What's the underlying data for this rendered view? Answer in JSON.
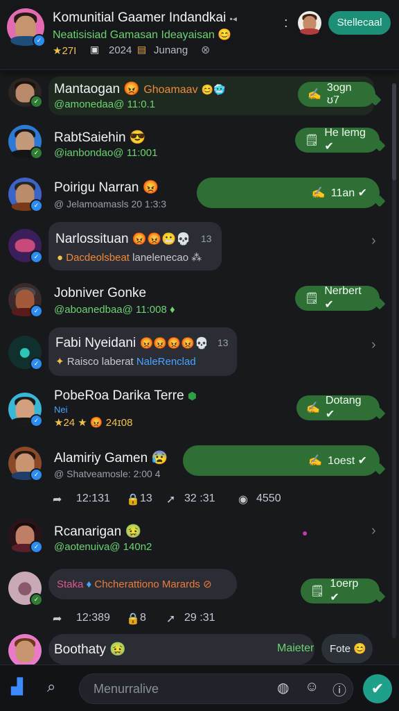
{
  "header": {
    "title": "Komunitial Gaamer Indandkai",
    "title_mark": "▪◂",
    "subtitle": "Neatisisiad Gamasan Ideayaisan",
    "subtitle_emoji": "😊",
    "stat_rating": "★27I",
    "stat_year": "2024",
    "stat_label": "Junang",
    "dots": ":",
    "button_label": "Stellecaal"
  },
  "chats": [
    {
      "name": "Mantaogan",
      "tag": "Ghoamaav",
      "emojis": "😡",
      "tag_emojis": "😊🥶",
      "handle": "@amonedaa@ 11:0.1",
      "action": {
        "icon": "✍",
        "label": "3ogn  ʊ7"
      }
    },
    {
      "name": "RabtSaiehin",
      "emojis": "😎",
      "handle": "@ianbondao@ 11:001",
      "action": {
        "icon": "🗒",
        "label": "He lemg ✔"
      }
    },
    {
      "name": "Poirigu Narran",
      "emojis": "😡",
      "handle": "@ Jelamoamasls 20 1:3:3",
      "action": {
        "icon": "✍",
        "label": "11an ✔"
      }
    },
    {
      "name": "Narlossituan",
      "emojis": "😡😡😬💀",
      "count": "13",
      "preview_left": "Dacdeolsbeat",
      "preview_right": "lanelenecao ⁂"
    },
    {
      "name": "Jobniver Gonke",
      "handle": "@aboanedbaa@ 11:008 ♦",
      "action": {
        "icon": "🗒",
        "label": "Nerbert ✔"
      }
    },
    {
      "name": "Fabi Nyeidani",
      "emojis": "😡😡😡😡💀",
      "count": "13",
      "preview_left": "Raisco laberat",
      "preview_right": "NaleRenclad"
    },
    {
      "name": "PobeRoa Darika Terre",
      "sub": "Nei",
      "stats": "★24  ★ 😡 24ɪ08",
      "action": {
        "icon": "✍",
        "label": "Dotang ✔"
      }
    },
    {
      "name": "Alamiriy Gamen",
      "emojis": "😰",
      "handle": "@ Shatveamosle: 2:00 4",
      "action": {
        "icon": "✍",
        "label": "1oest ✔"
      }
    },
    {
      "name": "Rcanarigan",
      "emojis": "🤢",
      "handle": "@aotenuiva@ 140n2"
    },
    {
      "name": "",
      "preview_left": "Staka",
      "preview_right": "Chcherattiono Marards",
      "action": {
        "icon": "🗒",
        "label": "1oerp ✔"
      }
    },
    {
      "name": "Boothaty",
      "emojis": "🤢",
      "right_label": "Maieter",
      "right_button": "Fote 😊"
    }
  ],
  "actions_a": {
    "reply": "12:131",
    "lock": "13",
    "share": "32 :31",
    "views": "4550"
  },
  "actions_b": {
    "reply": "12:389",
    "lock": "8",
    "share": "29 :31"
  },
  "composer": {
    "placeholder": "Menurralive"
  },
  "colors": {
    "accent": "#2e6f36",
    "send": "#1fa08a",
    "link": "#6cd46f"
  }
}
